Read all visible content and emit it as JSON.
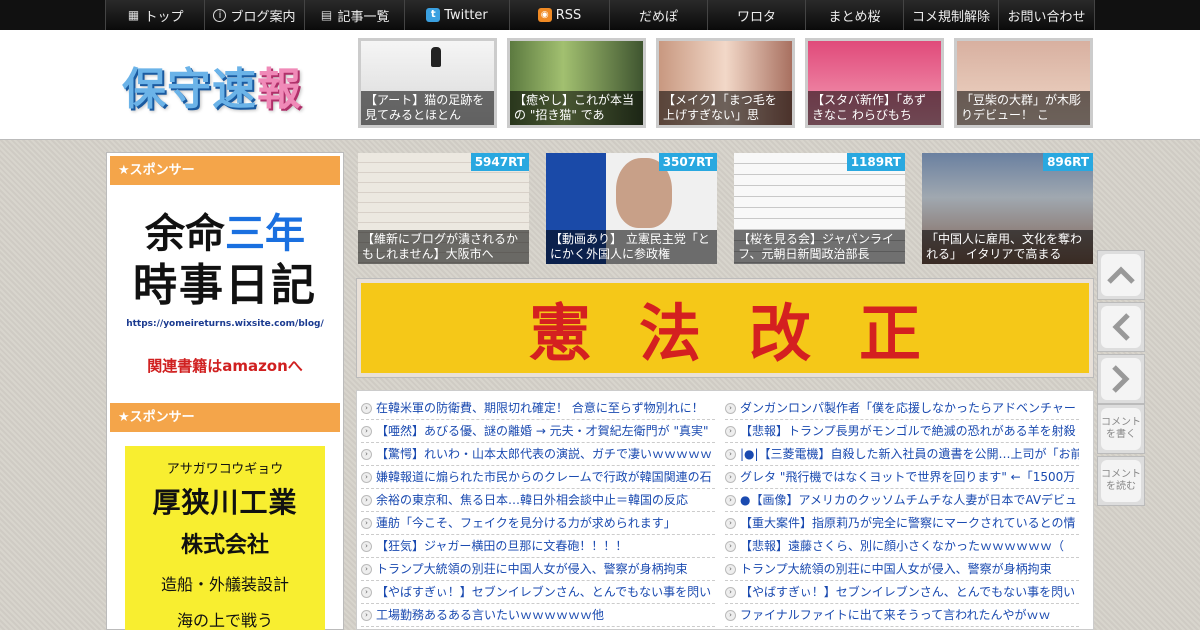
{
  "nav": {
    "items": [
      {
        "label": "トップ",
        "icon": "home-icon",
        "glyph": "▦"
      },
      {
        "label": "ブログ案内",
        "icon": "info-icon",
        "glyph": "i"
      },
      {
        "label": "記事一覧",
        "icon": "list-icon",
        "glyph": "▤"
      },
      {
        "label": "Twitter",
        "icon": "twitter-icon",
        "glyph": "t"
      },
      {
        "label": "RSS",
        "icon": "rss-icon",
        "glyph": "◉"
      },
      {
        "label": "だめぽ"
      },
      {
        "label": "ワロタ"
      },
      {
        "label": "まとめ桜"
      },
      {
        "label": "コメ規制解除"
      },
      {
        "label": "お問い合わせ"
      }
    ]
  },
  "header": {
    "logo_part1": "保守速",
    "logo_part2": "報",
    "thumbs": [
      {
        "caption": "【アート】猫の足跡を見てみるとほとん"
      },
      {
        "caption": "【癒やし】これが本当の \"招き猫\" であ"
      },
      {
        "caption": "【メイク】「まつ毛を上げすぎない」思"
      },
      {
        "caption": "【スタバ新作】「あずきなこ わらびもち"
      },
      {
        "caption": "「豆柴の大群」が木彫りデビュー！ こ"
      }
    ]
  },
  "sidebar": {
    "sponsor_label": "★スポンサー",
    "ad1": {
      "line1_a": "余命",
      "line1_b": "三年",
      "line2": "時事日記",
      "url": "https://yomeireturns.wixsite.com/blog/",
      "amazon": "関連書籍はamazonへ"
    },
    "sponsor_label2": "★スポンサー",
    "ad2": {
      "kana": "アサガワコウギョウ",
      "name": "厚狭川工業",
      "corp": "株式会社",
      "service": "造船・外艤装設計",
      "tagline": "海の上で戦う"
    }
  },
  "main": {
    "thumbs": [
      {
        "rt": "5947RT",
        "caption": "【維新にブログが潰されるかもしれません】大阪市へ"
      },
      {
        "rt": "3507RT",
        "caption": "【動画あり】 立憲民主党「とにかく外国人に参政権"
      },
      {
        "rt": "1189RT",
        "caption": "【桜を見る会】ジャパンライフ、元朝日新聞政治部長"
      },
      {
        "rt": "896RT",
        "caption": "「中国人に雇用、文化を奪われる」 イタリアで高まる"
      }
    ],
    "banner_text": "憲法改正"
  },
  "lists": {
    "left": [
      "在韓米軍の防衛費、期限切れ確定！ 合意に至らず物別れに！",
      "【唖然】あびる優、謎の離婚 → 元夫・才賀紀左衛門が \"真実\"",
      "【驚愕】れいわ・山本太郎代表の演説、ガチで凄いｗｗｗｗｗ",
      "嫌韓報道に煽られた市民からのクレームで行政が韓国関連の石",
      "余裕の東京和、焦る日本…韓日外相会談中止＝韓国の反応",
      "蓮舫「今こそ、フェイクを見分ける力が求められます」",
      "【狂気】ジャガー横田の旦那に文春砲！！！！",
      "トランプ大統領の別荘に中国人女が侵入、警察が身柄拘束",
      "【やばすぎぃ！】セブンイレブンさん、とんでもない事を閃い",
      "工場勤務あるある言いたいｗｗｗｗｗｗ他"
    ],
    "right": [
      "ダンガンロンパ製作者「僕を応援しなかったらアドベンチャー",
      "【悲報】トランプ長男がモンゴルで絶滅の恐れがある羊を射殺",
      "|●|【三菱電機】自殺した新入社員の遺書を公開…上司が「お前",
      "グレタ \"飛行機ではなくヨットで世界を回ります\" ←「1500万",
      "●【画像】アメリカのクッソムチムチな人妻が日本でAVデビュ",
      "【重大案件】指原莉乃が完全に警察にマークされているとの情",
      "【悲報】遠藤さくら、別に顔小さくなかったｗｗｗｗｗｗ（",
      "トランプ大統領の別荘に中国人女が侵入、警察が身柄拘束",
      "【やばすぎぃ！】セブンイレブンさん、とんでもない事を閃い",
      "ファイナルファイトに出て来そうって言われたんやがｗｗ"
    ]
  },
  "float": {
    "comment_write": "コメント を書く",
    "comment_read": "コメント を読む"
  }
}
